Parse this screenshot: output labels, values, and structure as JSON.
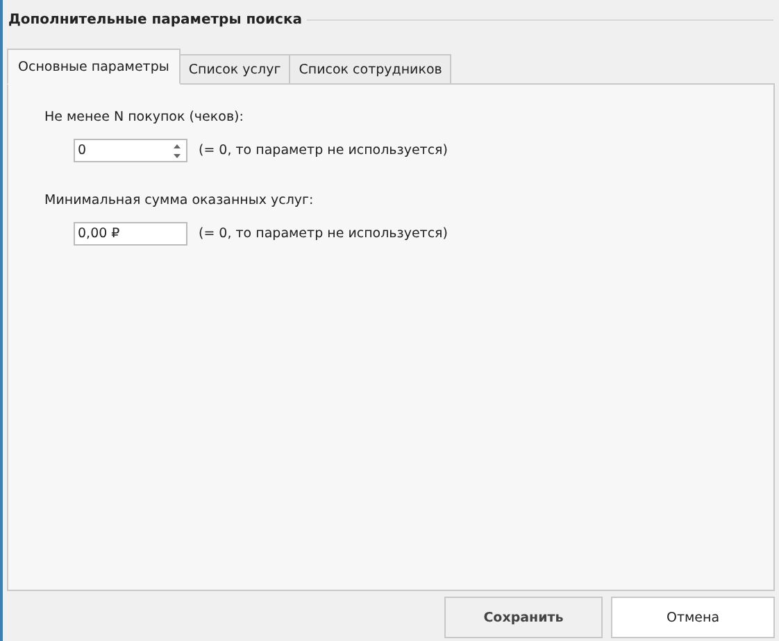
{
  "group": {
    "title": "Дополнительные параметры поиска"
  },
  "tabs": [
    {
      "label": "Основные параметры",
      "selected": true
    },
    {
      "label": "Список услуг",
      "selected": false
    },
    {
      "label": "Список сотрудников",
      "selected": false
    }
  ],
  "fields": [
    {
      "kind": "spin",
      "label": "Не менее N покупок (чеков):",
      "value": "0",
      "hint": "(= 0, то параметр не используется)"
    },
    {
      "kind": "money",
      "label": "Минимальная сумма оказанных услуг:",
      "value": "0,00 ₽",
      "hint": "(= 0, то параметр не используется)"
    }
  ],
  "buttons": [
    {
      "label": "Сохранить",
      "kind": "primary"
    },
    {
      "label": "Отмена",
      "kind": "secondary"
    }
  ]
}
